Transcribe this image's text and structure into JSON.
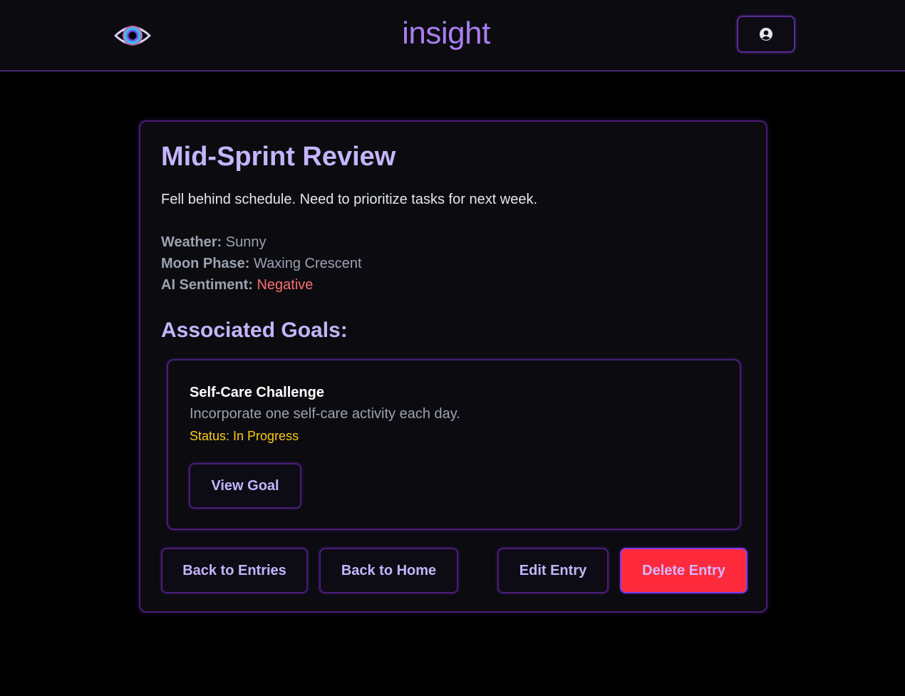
{
  "header": {
    "app_title": "insight",
    "logo_icon": "eye-icon",
    "profile_icon": "user-circle-icon"
  },
  "entry": {
    "title": "Mid-Sprint Review",
    "body": "Fell behind schedule. Need to prioritize tasks for next week.",
    "weather_label": "Weather:",
    "weather_value": "Sunny",
    "moon_label": "Moon Phase:",
    "moon_value": "Waxing Crescent",
    "sentiment_label": "AI Sentiment:",
    "sentiment_value": "Negative"
  },
  "goals": {
    "heading": "Associated Goals:",
    "items": [
      {
        "title": "Self-Care Challenge",
        "description": "Incorporate one self-care activity each day.",
        "status": "Status: In Progress",
        "button_label": "View Goal"
      }
    ]
  },
  "actions": {
    "back_entries": "Back to Entries",
    "back_home": "Back to Home",
    "edit": "Edit Entry",
    "delete": "Delete Entry"
  },
  "colors": {
    "accent": "#a87ef0",
    "heading": "#c4b5fd",
    "border": "#4a1d78",
    "negative": "#f87171",
    "status": "#facc15",
    "danger": "#ff2b3d"
  }
}
